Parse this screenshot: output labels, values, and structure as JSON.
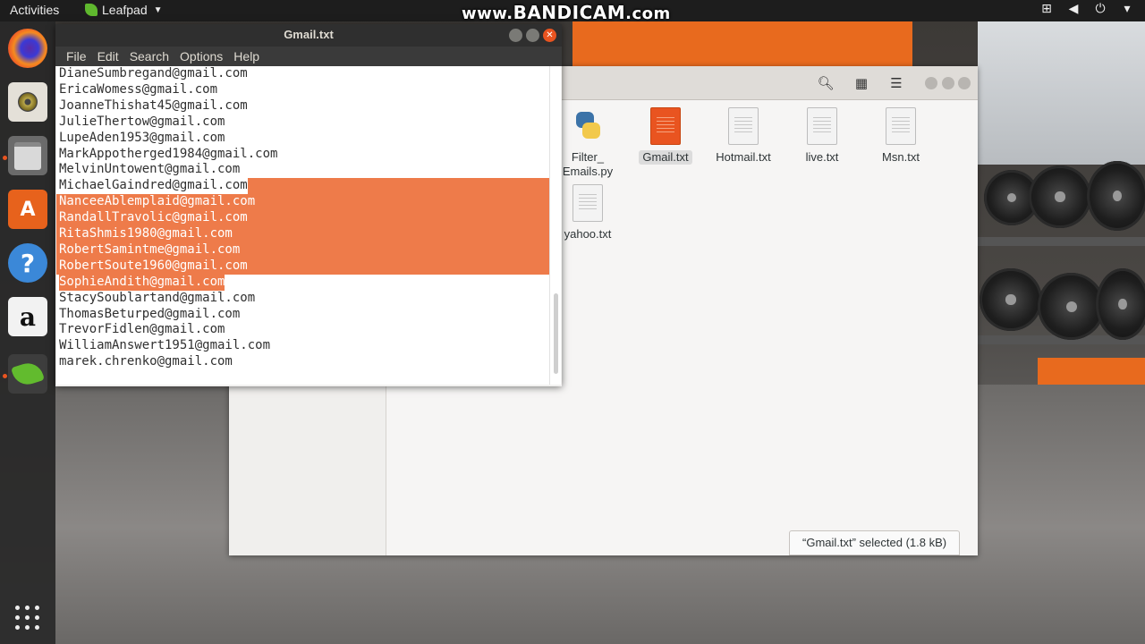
{
  "topbar": {
    "activities": "Activities",
    "app_name": "Leafpad",
    "watermark_prefix": "www.",
    "watermark_brand": "BANDICAM",
    "watermark_suffix": ".com"
  },
  "dock": {
    "items": [
      "Firefox",
      "Rhythmbox",
      "Files",
      "Ubuntu Software",
      "Help",
      "Amazon",
      "Leafpad"
    ]
  },
  "leafpad": {
    "title": "Gmail.txt",
    "menu": [
      "File",
      "Edit",
      "Search",
      "Options",
      "Help"
    ],
    "lines": [
      "DianeSumbregand@gmail.com",
      "EricaWomess@gmail.com",
      "JoanneThishat45@gmail.com",
      "JulieThertow@gmail.com",
      "LupeAden1953@gmail.com",
      "MarkAppotherged1984@gmail.com",
      "MelvinUntowent@gmail.com",
      "MichaelGaindred@gmail.com",
      "NanceeAblemplaid@gmail.com",
      "RandallTravolic@gmail.com",
      "RitaShmis1980@gmail.com",
      "RobertSamintme@gmail.com",
      "RobertSoute1960@gmail.com",
      "SophieAndith@gmail.com",
      "StacySoublartand@gmail.com",
      "ThomasBeturped@gmail.com",
      "TrevorFidlen@gmail.com",
      "WilliamAnswert1951@gmail.com",
      "marek.chrenko@gmail.com"
    ],
    "selected_lines": [
      8,
      9,
      10,
      11,
      12,
      13
    ]
  },
  "files": {
    "items": [
      {
        "name_line1": "Filter_",
        "name_line2": "Emails.py",
        "type": "python"
      },
      {
        "name_line1": "Gmail.txt",
        "name_line2": "",
        "type": "text",
        "selected": true
      },
      {
        "name_line1": "Hotmail.txt",
        "name_line2": "",
        "type": "text"
      },
      {
        "name_line1": "live.txt",
        "name_line2": "",
        "type": "text"
      },
      {
        "name_line1": "Msn.txt",
        "name_line2": "",
        "type": "text"
      },
      {
        "name_line1": "yahoo.txt",
        "name_line2": "",
        "type": "text"
      }
    ],
    "status": "“Gmail.txt” selected  (1.8 kB)"
  },
  "colors": {
    "selection": "#ee7b4a",
    "accent": "#e95420"
  }
}
